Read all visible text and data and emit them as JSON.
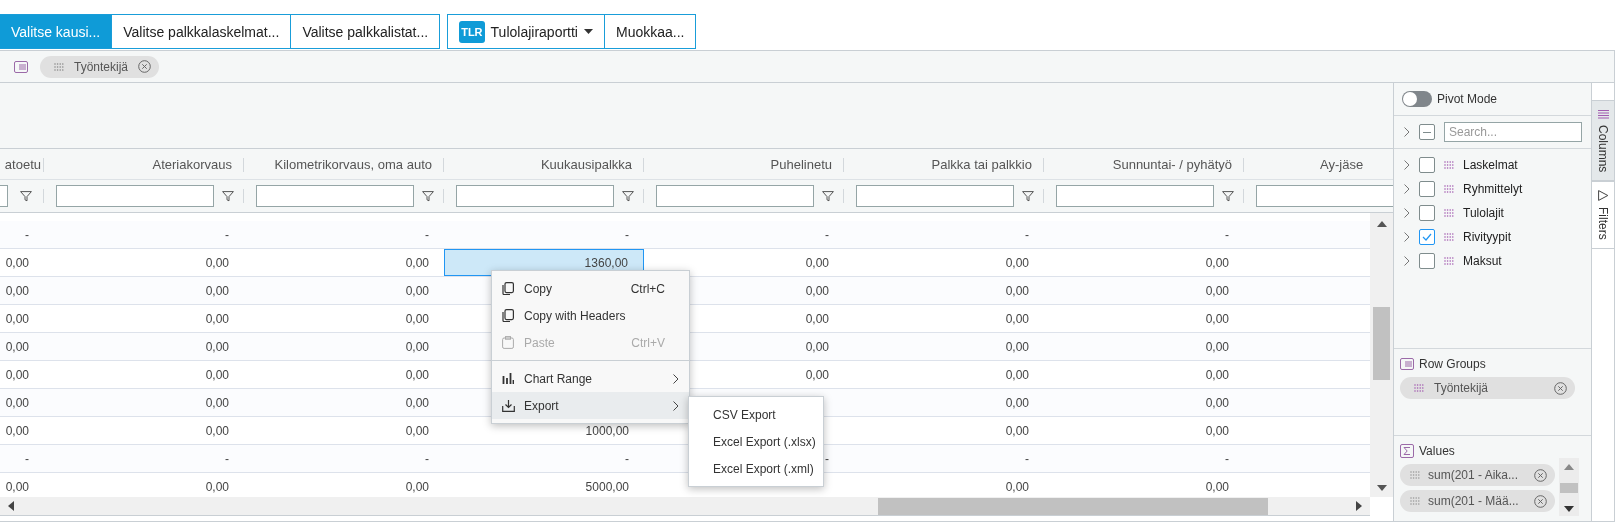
{
  "toolbar": {
    "groups": [
      {
        "buttons": [
          {
            "kind": "plain",
            "label": "Valitse kausi...",
            "selected": true
          },
          {
            "kind": "plain",
            "label": "Valitse palkkalaskelmat...",
            "selected": false
          },
          {
            "kind": "plain",
            "label": "Valitse palkkalistat...",
            "selected": false
          }
        ]
      },
      {
        "buttons": [
          {
            "kind": "dropdown",
            "badge": "TLR",
            "label": "Tulolajiraportti",
            "selected": false
          },
          {
            "kind": "plain",
            "label": "Muokkaa...",
            "selected": false
          }
        ]
      }
    ]
  },
  "row_group_bar": {
    "chips": [
      {
        "label": "Työntekijä"
      }
    ]
  },
  "grid": {
    "columns": [
      {
        "header": "atoetu"
      },
      {
        "header": "Ateriakorvaus"
      },
      {
        "header": "Kilometrikorvaus, oma auto"
      },
      {
        "header": "Kuukausipalkka"
      },
      {
        "header": "Puhelinetu"
      },
      {
        "header": "Palkka tai palkkio"
      },
      {
        "header": "Sunnuntai- / pyhätyö"
      },
      {
        "header": "Ay-jäse"
      }
    ],
    "rows": [
      {
        "cells": [
          {
            "text": "-",
            "selected": false
          },
          {
            "text": "-",
            "selected": false
          },
          {
            "text": "-",
            "selected": false
          },
          {
            "text": "-",
            "selected": false
          },
          {
            "text": "-",
            "selected": false
          },
          {
            "text": "-",
            "selected": false
          },
          {
            "text": "-",
            "selected": false
          }
        ]
      },
      {
        "cells": [
          {
            "text": "0,00",
            "selected": false
          },
          {
            "text": "0,00",
            "selected": false
          },
          {
            "text": "0,00",
            "selected": false
          },
          {
            "text": "1360,00",
            "selected": true
          },
          {
            "text": "0,00",
            "selected": false
          },
          {
            "text": "0,00",
            "selected": false
          },
          {
            "text": "0,00",
            "selected": false
          }
        ]
      },
      {
        "cells": [
          {
            "text": "0,00",
            "selected": false
          },
          {
            "text": "0,00",
            "selected": false
          },
          {
            "text": "0,00",
            "selected": false
          },
          null,
          {
            "text": "0,00",
            "selected": false
          },
          {
            "text": "0,00",
            "selected": false
          },
          {
            "text": "0,00",
            "selected": false
          }
        ]
      },
      {
        "cells": [
          {
            "text": "0,00",
            "selected": false
          },
          {
            "text": "0,00",
            "selected": false
          },
          {
            "text": "0,00",
            "selected": false
          },
          null,
          {
            "text": "0,00",
            "selected": false
          },
          {
            "text": "0,00",
            "selected": false
          },
          {
            "text": "0,00",
            "selected": false
          }
        ]
      },
      {
        "cells": [
          {
            "text": "0,00",
            "selected": false
          },
          {
            "text": "0,00",
            "selected": false
          },
          {
            "text": "0,00",
            "selected": false
          },
          null,
          {
            "text": "0,00",
            "selected": false
          },
          {
            "text": "0,00",
            "selected": false
          },
          {
            "text": "0,00",
            "selected": false
          }
        ]
      },
      {
        "cells": [
          {
            "text": "0,00",
            "selected": false
          },
          {
            "text": "0,00",
            "selected": false
          },
          {
            "text": "0,00",
            "selected": false
          },
          null,
          {
            "text": "0,00",
            "selected": false
          },
          {
            "text": "0,00",
            "selected": false
          },
          {
            "text": "0,00",
            "selected": false
          }
        ]
      },
      {
        "cells": [
          {
            "text": "0,00",
            "selected": false
          },
          {
            "text": "0,00",
            "selected": false
          },
          {
            "text": "0,00",
            "selected": false
          },
          null,
          null,
          {
            "text": "0,00",
            "selected": false
          },
          {
            "text": "0,00",
            "selected": false
          }
        ]
      },
      {
        "cells": [
          {
            "text": "0,00",
            "selected": false
          },
          {
            "text": "0,00",
            "selected": false
          },
          {
            "text": "0,00",
            "selected": false
          },
          {
            "text": "1000,00",
            "selected": false
          },
          null,
          {
            "text": "0,00",
            "selected": false
          },
          {
            "text": "0,00",
            "selected": false
          }
        ]
      },
      {
        "cells": [
          {
            "text": "-",
            "selected": false
          },
          {
            "text": "-",
            "selected": false
          },
          {
            "text": "-",
            "selected": false
          },
          {
            "text": "-",
            "selected": false
          },
          {
            "text": "-",
            "selected": false
          },
          {
            "text": "-",
            "selected": false
          },
          {
            "text": "-",
            "selected": false
          }
        ]
      },
      {
        "cells": [
          {
            "text": "0,00",
            "selected": false
          },
          {
            "text": "0,00",
            "selected": false
          },
          {
            "text": "0,00",
            "selected": false
          },
          {
            "text": "5000,00",
            "selected": false
          },
          null,
          {
            "text": "0,00",
            "selected": false
          },
          {
            "text": "0,00",
            "selected": false
          }
        ]
      }
    ]
  },
  "context_menu": {
    "items": [
      {
        "kind": "copy",
        "label": "Copy",
        "shortcut": "Ctrl+C",
        "disabled": false,
        "selected": false,
        "expandable": false
      },
      {
        "kind": "copy",
        "label": "Copy with Headers",
        "disabled": false,
        "selected": false,
        "expandable": false
      },
      {
        "kind": "paste",
        "label": "Paste",
        "shortcut": "Ctrl+V",
        "disabled": true,
        "selected": false,
        "expandable": false
      },
      {
        "kind": "separator"
      },
      {
        "kind": "chart",
        "label": "Chart Range",
        "disabled": false,
        "selected": false,
        "expandable": true
      },
      {
        "kind": "export",
        "label": "Export",
        "disabled": false,
        "selected": true,
        "expandable": true,
        "submenu": [
          {
            "label": "CSV Export"
          },
          {
            "label": "Excel Export (.xlsx)"
          },
          {
            "label": "Excel Export (.xml)"
          }
        ]
      }
    ]
  },
  "side_panel": {
    "pivot_mode": {
      "label": "Pivot Mode",
      "on": false
    },
    "search": {
      "placeholder": "Search...",
      "expanded": false,
      "select_all_indeterminate": true
    },
    "columns": [
      {
        "label": "Laskelmat",
        "checked": false,
        "expanded": false
      },
      {
        "label": "Ryhmittelyt",
        "checked": false,
        "expanded": false
      },
      {
        "label": "Tulolajit",
        "checked": false,
        "expanded": false
      },
      {
        "label": "Rivityypit",
        "checked": true,
        "expanded": false
      },
      {
        "label": "Maksut",
        "checked": false,
        "expanded": false
      }
    ],
    "row_groups": {
      "title": "Row Groups",
      "chips": [
        {
          "label": "Työntekijä"
        }
      ]
    },
    "values": {
      "title": "Values",
      "chips": [
        {
          "label": "sum(201 - Aika..."
        },
        {
          "label": "sum(201 - Mää..."
        }
      ]
    }
  },
  "side_tabs": [
    {
      "kind": "columns",
      "label": "Columns",
      "selected": true
    },
    {
      "kind": "filters",
      "label": "Filters",
      "selected": false
    }
  ]
}
